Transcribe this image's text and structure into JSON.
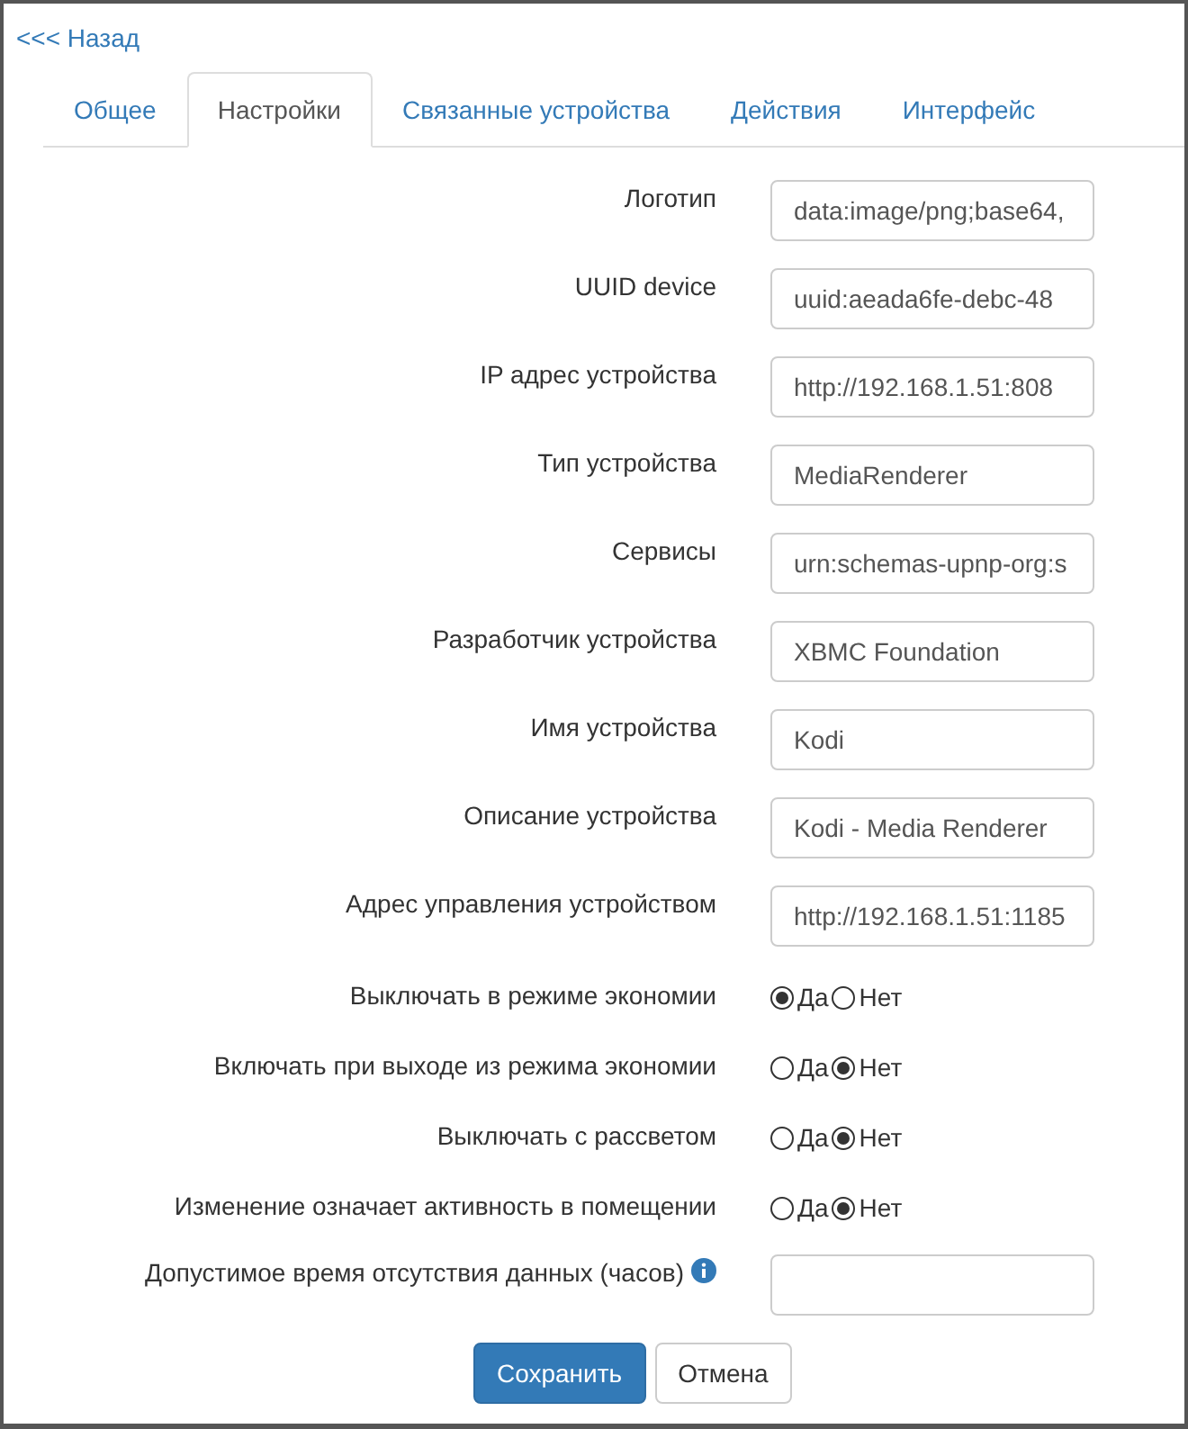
{
  "back_link": "<<< Назад",
  "tabs": [
    {
      "label": "Общее",
      "selected": false
    },
    {
      "label": "Настройки",
      "selected": true
    },
    {
      "label": "Связанные устройства",
      "selected": false
    },
    {
      "label": "Действия",
      "selected": false
    },
    {
      "label": "Интерфейс",
      "selected": false
    }
  ],
  "fields": [
    {
      "kind": "text",
      "label": "Логотип",
      "value": "data:image/png;base64,"
    },
    {
      "kind": "text",
      "label": "UUID device",
      "value": "uuid:aeada6fe-debc-48"
    },
    {
      "kind": "text",
      "label": "IP адрес устройства",
      "value": "http://192.168.1.51:808"
    },
    {
      "kind": "text",
      "label": "Тип устройства",
      "value": "MediaRenderer"
    },
    {
      "kind": "text",
      "label": "Сервисы",
      "value": "urn:schemas-upnp-org:s"
    },
    {
      "kind": "text",
      "label": "Разработчик устройства",
      "value": "XBMC Foundation"
    },
    {
      "kind": "text",
      "label": "Имя устройства",
      "value": "Kodi"
    },
    {
      "kind": "text",
      "label": "Описание устройства",
      "value": "Kodi - Media Renderer"
    },
    {
      "kind": "text",
      "label": "Адрес управления устройством",
      "value": "http://192.168.1.51:1185"
    },
    {
      "kind": "radio",
      "label": "Выключать в режиме экономии",
      "options": [
        {
          "label": "Да",
          "selected": true
        },
        {
          "label": "Нет",
          "selected": false
        }
      ]
    },
    {
      "kind": "radio",
      "label": "Включать при выходе из режима экономии",
      "options": [
        {
          "label": "Да",
          "selected": false
        },
        {
          "label": "Нет",
          "selected": true
        }
      ]
    },
    {
      "kind": "radio",
      "label": "Выключать с рассветом",
      "options": [
        {
          "label": "Да",
          "selected": false
        },
        {
          "label": "Нет",
          "selected": true
        }
      ]
    },
    {
      "kind": "radio",
      "label": "Изменение означает активность в помещении",
      "options": [
        {
          "label": "Да",
          "selected": false
        },
        {
          "label": "Нет",
          "selected": true
        }
      ]
    },
    {
      "kind": "text",
      "label": "Допустимое время отсутствия данных (часов)",
      "info": true
    }
  ],
  "buttons": [
    {
      "kind": "primary",
      "label": "Сохранить"
    },
    {
      "kind": "default",
      "label": "Отмена"
    }
  ]
}
